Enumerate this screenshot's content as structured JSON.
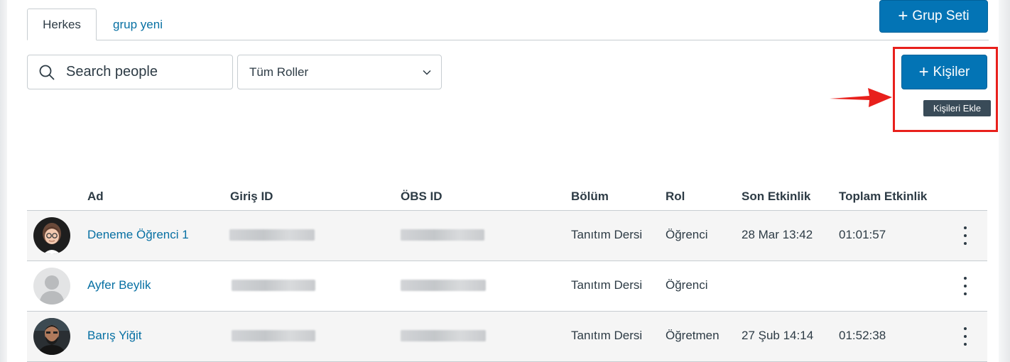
{
  "tabs": [
    {
      "label": "Herkes"
    },
    {
      "label": "grup yeni"
    }
  ],
  "buttons": {
    "group_set": "Grup Seti",
    "people": "Kişiler",
    "plus_glyph": "+"
  },
  "search": {
    "placeholder": "Search people",
    "value": ""
  },
  "role_filter": {
    "selected": "Tüm Roller"
  },
  "tooltip": "Kişileri Ekle",
  "annotation": {
    "color": "#e8201c"
  },
  "colors": {
    "accent": "#0374b5",
    "link": "#0770a3"
  },
  "table": {
    "headers": [
      "Ad",
      "Giriş ID",
      "ÖBS ID",
      "Bölüm",
      "Rol",
      "Son Etkinlik",
      "Toplam Etkinlik"
    ],
    "rows": [
      {
        "name": "Deneme Öğrenci 1",
        "section": "Tanıtım Dersi",
        "role": "Öğrenci",
        "last_activity": "28 Mar 13:42",
        "total_activity": "01:01:57",
        "avatar": "memoji-avatar"
      },
      {
        "name": "Ayfer Beylik",
        "section": "Tanıtım Dersi",
        "role": "Öğrenci",
        "last_activity": "",
        "total_activity": "",
        "avatar": "default-avatar"
      },
      {
        "name": "Barış Yiğit",
        "section": "Tanıtım Dersi",
        "role": "Öğretmen",
        "last_activity": "27 Şub 14:14",
        "total_activity": "01:52:38",
        "avatar": "photo-avatar"
      }
    ]
  }
}
